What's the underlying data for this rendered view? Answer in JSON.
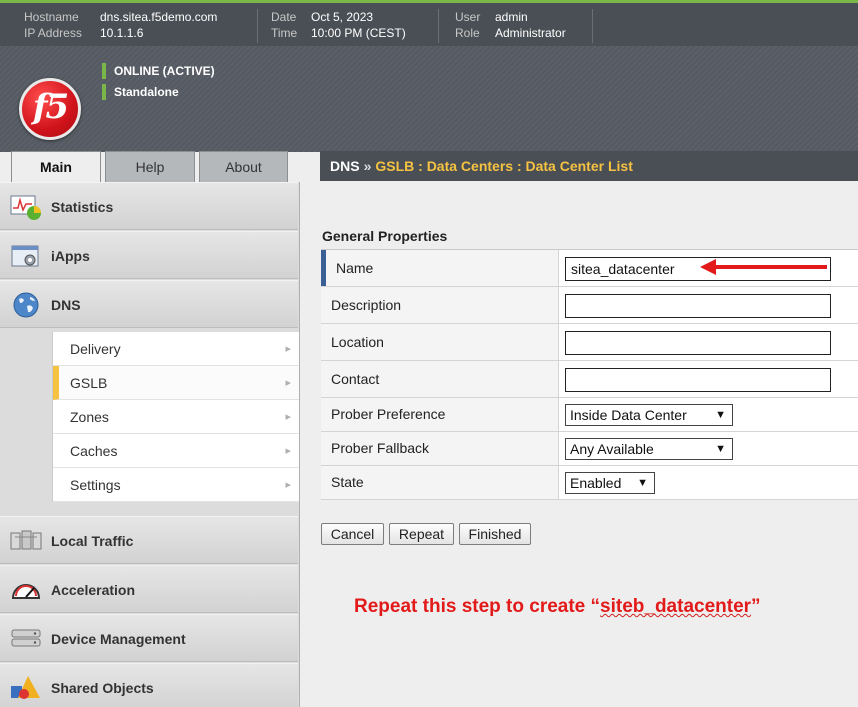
{
  "topbar": {
    "hostname_label": "Hostname",
    "hostname": "dns.sitea.f5demo.com",
    "ip_label": "IP Address",
    "ip": "10.1.1.6",
    "date_label": "Date",
    "date": "Oct 5, 2023",
    "time_label": "Time",
    "time": "10:00 PM (CEST)",
    "user_label": "User",
    "user": "admin",
    "role_label": "Role",
    "role": "Administrator"
  },
  "banner": {
    "logo_text": "f5",
    "status": "ONLINE (ACTIVE)",
    "mode": "Standalone",
    "status_color": "#7ab648"
  },
  "tabs": [
    {
      "label": "Main",
      "active": true
    },
    {
      "label": "Help",
      "active": false
    },
    {
      "label": "About",
      "active": false
    }
  ],
  "breadcrumb": {
    "root": "DNS",
    "separator": "»",
    "path": "GSLB : Data Centers : Data Center List"
  },
  "sidebar": {
    "sections": [
      {
        "label": "Statistics",
        "icon": "statistics-icon"
      },
      {
        "label": "iApps",
        "icon": "iapps-icon"
      },
      {
        "label": "DNS",
        "icon": "globe-icon"
      },
      {
        "label": "Local Traffic",
        "icon": "local-traffic-icon"
      },
      {
        "label": "Acceleration",
        "icon": "gauge-icon"
      },
      {
        "label": "Device Management",
        "icon": "device-icon"
      },
      {
        "label": "Shared Objects",
        "icon": "shapes-icon"
      }
    ],
    "dns_items": [
      {
        "label": "Delivery",
        "active": false
      },
      {
        "label": "GSLB",
        "active": true
      },
      {
        "label": "Zones",
        "active": false
      },
      {
        "label": "Caches",
        "active": false
      },
      {
        "label": "Settings",
        "active": false
      }
    ],
    "arrow_glyph": "▸"
  },
  "form": {
    "section_title": "General Properties",
    "name_label": "Name",
    "name_value": "sitea_datacenter",
    "description_label": "Description",
    "description_value": "",
    "location_label": "Location",
    "location_value": "",
    "contact_label": "Contact",
    "contact_value": "",
    "prober_preference_label": "Prober Preference",
    "prober_preference_value": "Inside Data Center",
    "prober_fallback_label": "Prober Fallback",
    "prober_fallback_value": "Any Available",
    "state_label": "State",
    "state_value": "Enabled"
  },
  "buttons": {
    "cancel": "Cancel",
    "repeat": "Repeat",
    "finished": "Finished"
  },
  "annotation": {
    "text_prefix": "Repeat this step to create “",
    "text_highlight": "siteb_datacenter",
    "text_suffix": "”",
    "color": "#e31a1a"
  }
}
